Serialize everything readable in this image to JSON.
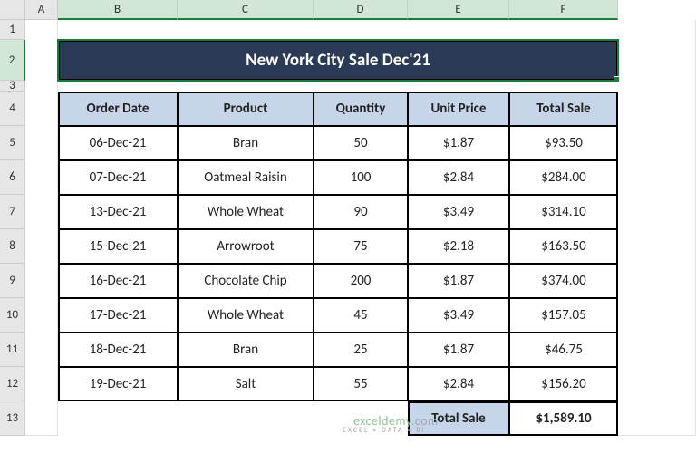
{
  "columns": [
    "A",
    "B",
    "C",
    "D",
    "E",
    "F"
  ],
  "row_numbers": [
    "1",
    "2",
    "3",
    "4",
    "5",
    "6",
    "7",
    "8",
    "9",
    "10",
    "11",
    "12",
    "13"
  ],
  "title": "New York City Sale Dec'21",
  "headers": {
    "order_date": "Order Date",
    "product": "Product",
    "quantity": "Quantity",
    "unit_price": "Unit Price",
    "total_sale": "Total Sale"
  },
  "rows": [
    {
      "date": "06-Dec-21",
      "product": "Bran",
      "qty": "50",
      "price": "$1.87",
      "total": "$93.50"
    },
    {
      "date": "07-Dec-21",
      "product": "Oatmeal Raisin",
      "qty": "100",
      "price": "$2.84",
      "total": "$284.00"
    },
    {
      "date": "13-Dec-21",
      "product": "Whole Wheat",
      "qty": "90",
      "price": "$3.49",
      "total": "$314.10"
    },
    {
      "date": "15-Dec-21",
      "product": "Arrowroot",
      "qty": "75",
      "price": "$2.18",
      "total": "$163.50"
    },
    {
      "date": "16-Dec-21",
      "product": "Chocolate Chip",
      "qty": "200",
      "price": "$1.87",
      "total": "$374.00"
    },
    {
      "date": "17-Dec-21",
      "product": "Whole Wheat",
      "qty": "45",
      "price": "$3.49",
      "total": "$157.05"
    },
    {
      "date": "18-Dec-21",
      "product": "Bran",
      "qty": "25",
      "price": "$1.87",
      "total": "$46.75"
    },
    {
      "date": "19-Dec-21",
      "product": "Salt",
      "qty": "55",
      "price": "$2.84",
      "total": "$156.20"
    }
  ],
  "footer": {
    "label": "Total Sale",
    "value": "$1,589.10"
  },
  "watermark": {
    "brand": "exceldemy",
    "tag": ".com"
  },
  "chart_data": {
    "type": "table",
    "title": "New York City Sale Dec'21",
    "columns": [
      "Order Date",
      "Product",
      "Quantity",
      "Unit Price",
      "Total Sale"
    ],
    "rows": [
      [
        "06-Dec-21",
        "Bran",
        50,
        1.87,
        93.5
      ],
      [
        "07-Dec-21",
        "Oatmeal Raisin",
        100,
        2.84,
        284.0
      ],
      [
        "13-Dec-21",
        "Whole Wheat",
        90,
        3.49,
        314.1
      ],
      [
        "15-Dec-21",
        "Arrowroot",
        75,
        2.18,
        163.5
      ],
      [
        "16-Dec-21",
        "Chocolate Chip",
        200,
        1.87,
        374.0
      ],
      [
        "17-Dec-21",
        "Whole Wheat",
        45,
        3.49,
        157.05
      ],
      [
        "18-Dec-21",
        "Bran",
        25,
        1.87,
        46.75
      ],
      [
        "19-Dec-21",
        "Salt",
        55,
        2.84,
        156.2
      ]
    ],
    "total": 1589.1
  }
}
